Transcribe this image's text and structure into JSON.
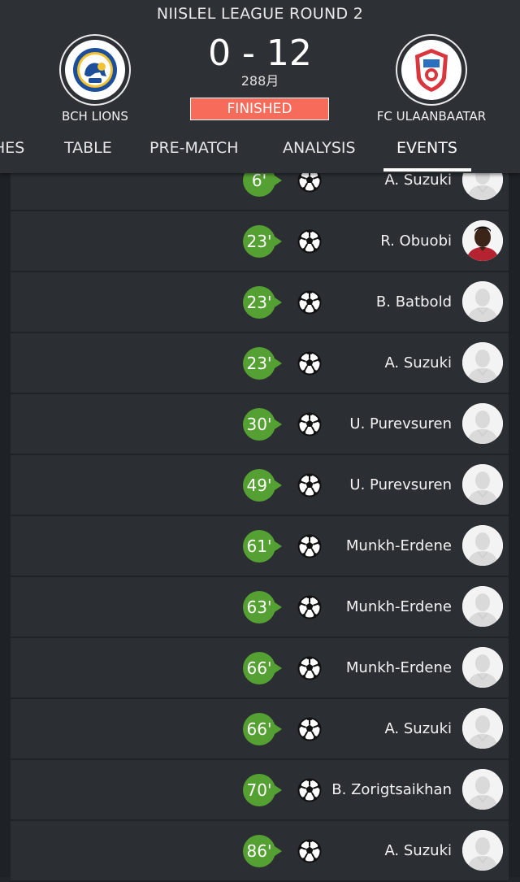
{
  "header": {
    "round_title": "NIISLEL LEAGUE ROUND 2",
    "home_team": "BCH LIONS",
    "away_team": "FC ULAANBAATAR",
    "score": "0 - 12",
    "date": "288月",
    "status": "FINISHED",
    "status_color": "#f76b5b"
  },
  "tabs": [
    {
      "label": "HES"
    },
    {
      "label": "TABLE"
    },
    {
      "label": "PRE-MATCH"
    },
    {
      "label": "ANALYSIS"
    },
    {
      "label": "EVENTS",
      "active": true
    }
  ],
  "events": [
    {
      "minute": "6'",
      "player": "A. Suzuki",
      "icon": "goal-ball-icon",
      "avatar": "placeholder"
    },
    {
      "minute": "23'",
      "player": "R. Obuobi",
      "icon": "goal-ball-icon",
      "avatar": "photo"
    },
    {
      "minute": "23'",
      "player": "B. Batbold",
      "icon": "goal-ball-icon",
      "avatar": "placeholder"
    },
    {
      "minute": "23'",
      "player": "A. Suzuki",
      "icon": "goal-ball-icon",
      "avatar": "placeholder"
    },
    {
      "minute": "30'",
      "player": "U. Purevsuren",
      "icon": "goal-ball-icon",
      "avatar": "placeholder"
    },
    {
      "minute": "49'",
      "player": "U. Purevsuren",
      "icon": "goal-ball-icon",
      "avatar": "placeholder"
    },
    {
      "minute": "61'",
      "player": "Munkh-Erdene",
      "icon": "goal-ball-icon",
      "avatar": "placeholder"
    },
    {
      "minute": "63'",
      "player": "Munkh-Erdene",
      "icon": "goal-ball-icon",
      "avatar": "placeholder"
    },
    {
      "minute": "66'",
      "player": "Munkh-Erdene",
      "icon": "goal-ball-icon",
      "avatar": "placeholder"
    },
    {
      "minute": "66'",
      "player": "A. Suzuki",
      "icon": "goal-ball-icon",
      "avatar": "placeholder"
    },
    {
      "minute": "70'",
      "player": "B. Zorigtsaikhan",
      "icon": "goal-ball-icon",
      "avatar": "placeholder"
    },
    {
      "minute": "86'",
      "player": "A. Suzuki",
      "icon": "goal-ball-icon",
      "avatar": "placeholder"
    }
  ],
  "colors": {
    "minute_badge": "#55a032",
    "background": "#2b2f34"
  }
}
